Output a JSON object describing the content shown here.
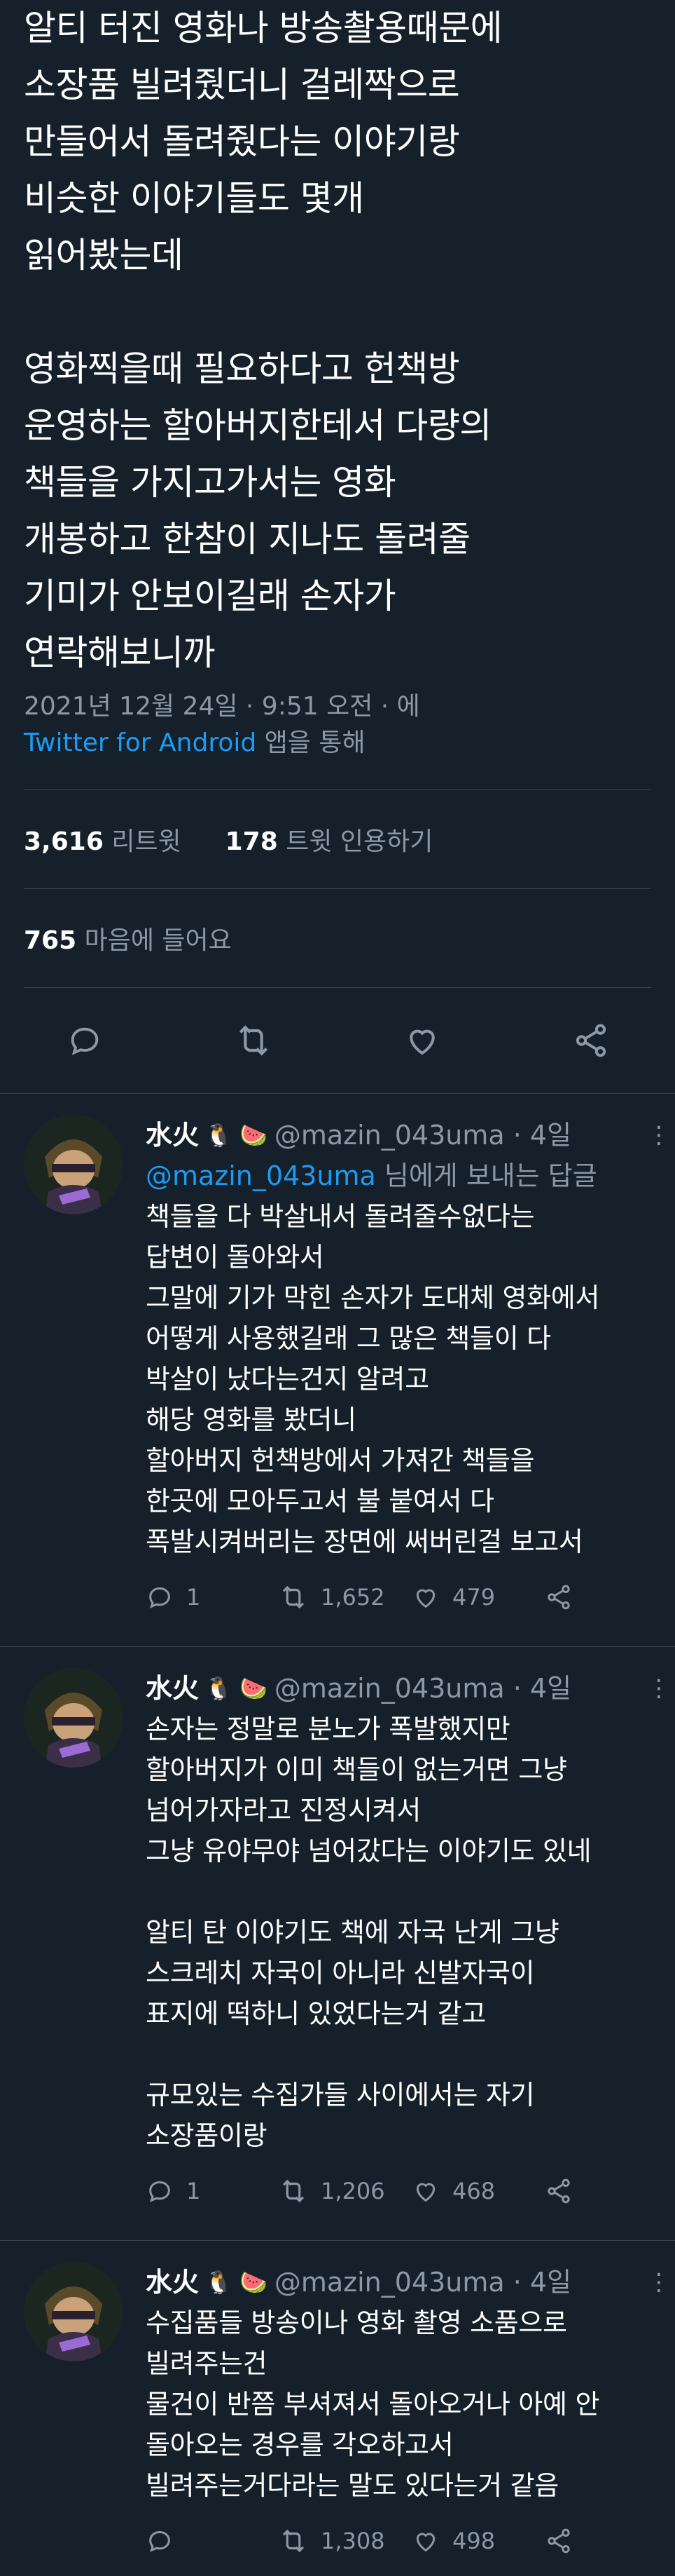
{
  "tweet": {
    "text": "알티 터진 영화나 방송촬용때문에\n소장품 빌려줬더니 걸레짝으로\n만들어서 돌려줬다는 이야기랑\n비슷한 이야기들도 몇개\n읽어봤는데\n\n영화찍을때 필요하다고 헌책방\n운영하는 할아버지한테서 다량의\n책들을 가지고가서는 영화\n개봉하고 한참이 지나도 돌려줄\n기미가 안보이길래 손자가\n연락해보니까",
    "timestamp": "2021년 12월 24일 · 9:51 오전 · 에",
    "source": "Twitter for Android",
    "source_suffix": " 앱을 통해",
    "retweets_count": "3,616",
    "retweets_label": " 리트윗",
    "quotes_count": "178",
    "quotes_label": " 트윗 인용하기",
    "likes_count": "765",
    "likes_label": " 마음에 들어요"
  },
  "icons": [
    "reply-icon",
    "retweet-icon",
    "like-icon",
    "share-icon"
  ],
  "replies": [
    {
      "name": "水火",
      "badges": "🐧 🍉",
      "handle": "@mazin_043uma · 4일",
      "more": "⋮",
      "replying_prefix": "",
      "mention": "@mazin_043uma",
      "replying_suffix": " 님에게 보내는 답글",
      "text": "책들을 다 박살내서 돌려줄수없다는\n답변이 돌아와서\n그말에 기가 막힌 손자가 도대체 영화에서\n어떻게 사용했길래 그 많은 책들이 다\n박살이 났다는건지 알려고\n해당 영화를 봤더니\n할아버지 헌책방에서 가져간 책들을\n한곳에 모아두고서 불 붙여서 다\n폭발시켜버리는 장면에 써버린걸 보고서",
      "reply_count": "1",
      "retweet_count": "1,652",
      "like_count": "479"
    },
    {
      "name": "水火",
      "badges": "🐧 🍉",
      "handle": "@mazin_043uma · 4일",
      "more": "⋮",
      "text": "손자는 정말로 분노가 폭발했지만\n할아버지가 이미 책들이 없는거면 그냥\n넘어가자라고 진정시켜서\n그냥 유야무야 넘어갔다는 이야기도 있네\n\n알티 탄 이야기도 책에 자국 난게 그냥\n스크레치 자국이 아니라 신발자국이\n표지에 떡하니 있었다는거 같고\n\n규모있는 수집가들 사이에서는 자기\n소장품이랑",
      "reply_count": "1",
      "retweet_count": "1,206",
      "like_count": "468"
    },
    {
      "name": "水火",
      "badges": "🐧 🍉",
      "handle": "@mazin_043uma · 4일",
      "more": "⋮",
      "text": "수집품들 방송이나 영화 촬영 소품으로\n빌려주는건\n물건이 반쯤 부셔져서 돌아오거나 아예 안\n돌아오는 경우를 각오하고서\n빌려주는거다라는 말도 있다는거 같음",
      "reply_count": "",
      "retweet_count": "1,308",
      "like_count": "498"
    }
  ]
}
